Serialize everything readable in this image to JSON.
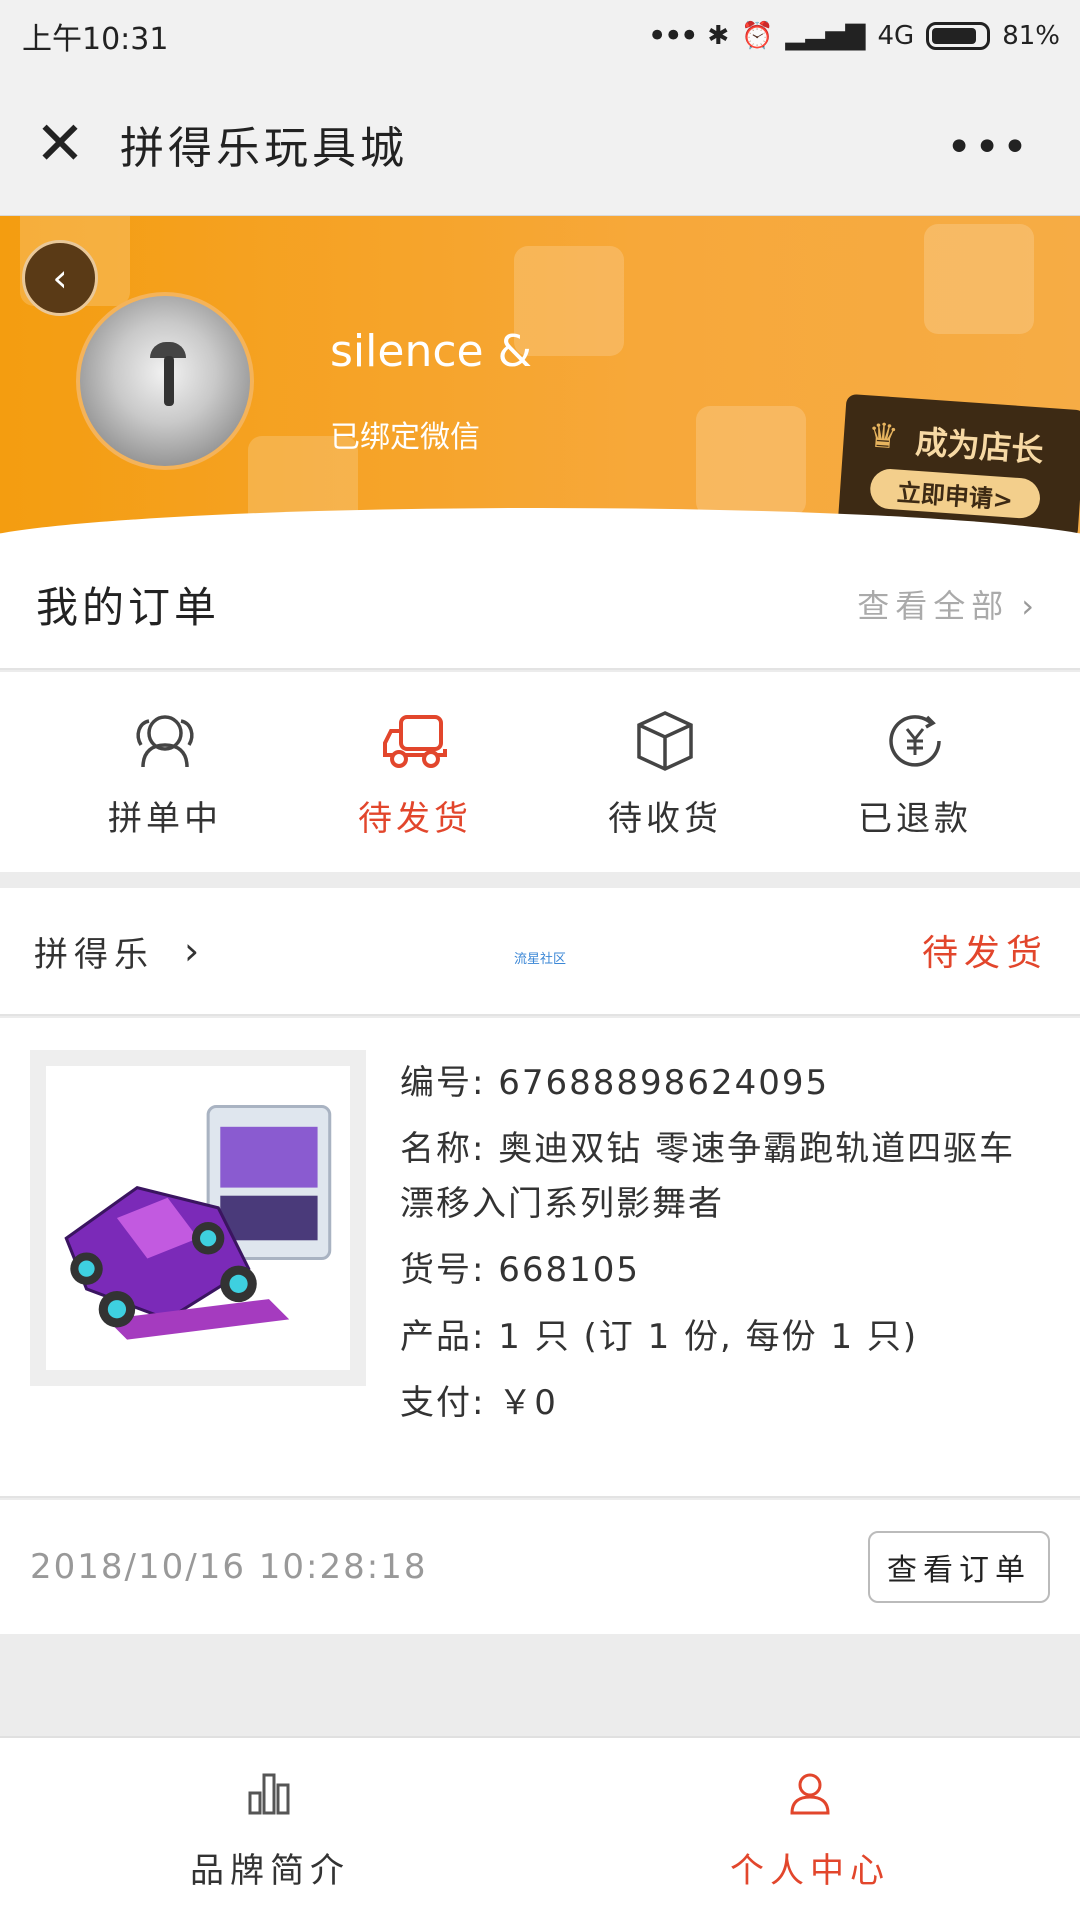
{
  "status_bar": {
    "time": "上午10:31",
    "network": "4G",
    "battery": "81%"
  },
  "title_bar": {
    "title": "拼得乐玩具城"
  },
  "profile": {
    "username": "silence &",
    "bind_status": "已绑定微信",
    "shop_card": {
      "title": "成为店长",
      "apply_label": "立即申请>"
    }
  },
  "orders": {
    "title": "我的订单",
    "view_all": "查看全部",
    "statuses": [
      {
        "label": "拼单中",
        "icon": "group-people-icon"
      },
      {
        "label": "待发货",
        "icon": "delivery-truck-icon",
        "active": true
      },
      {
        "label": "待收货",
        "icon": "package-box-icon"
      },
      {
        "label": "已退款",
        "icon": "refund-yen-icon"
      }
    ]
  },
  "order_card": {
    "store_name": "拼得乐",
    "community_link": "流星社区",
    "status": "待发货",
    "product": {
      "number_line": "编号: 67688898624095",
      "name_line": "名称: 奥迪双钻 零速争霸跑轨道四驱车 漂移入门系列影舞者",
      "sku_line": "货号: 668105",
      "quantity_line": "产品: 1 只 (订 1 份, 每份 1 只)",
      "payment_line": "支付: ￥0"
    },
    "time": "2018/10/16 10:28:18",
    "view_order_label": "查看订单"
  },
  "bottom_nav": {
    "brand_label": "品牌简介",
    "personal_label": "个人中心"
  },
  "colors": {
    "accent": "#e2462c",
    "banner_orange": "#f49d10"
  }
}
